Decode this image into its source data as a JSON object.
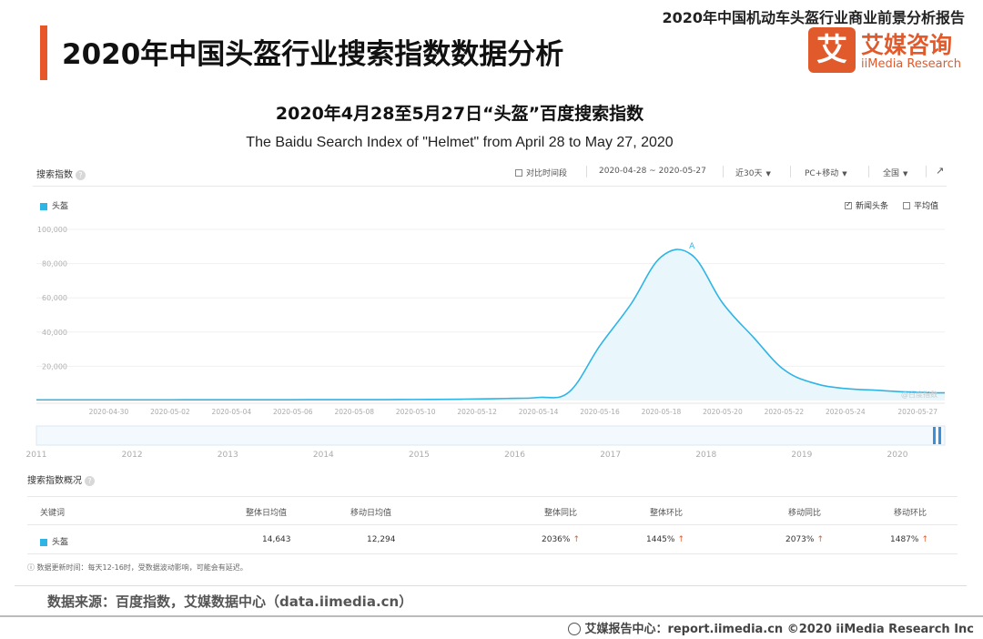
{
  "header": {
    "report_title": "2020年中国机动车头盔行业商业前景分析报告",
    "page_title": "2020年中国头盔行业搜索指数数据分析",
    "logo_mark": "艾",
    "logo_cn": "艾媒咨询",
    "logo_en": "iiMedia Research",
    "brand_color": "#e05a2b"
  },
  "chart_heading": {
    "title": "2020年4月28至5月27日“头盔”百度搜索指数",
    "subtitle": "The Baidu Search Index of \"Helmet\" from April 28 to May 27, 2020"
  },
  "screenshot": {
    "panel_label": "搜索指数",
    "help_icon": "?",
    "toolbar": {
      "compare_label": "对比时间段",
      "date_range": "2020-04-28 ~ 2020-05-27",
      "period": "近30天",
      "device": "PC+移动",
      "region": "全国",
      "share_icon": "share-icon"
    },
    "options": {
      "news_label": "新闻头条",
      "news_checked": true,
      "avg_label": "平均值",
      "avg_checked": false
    },
    "watermark": "@百度指数",
    "peak_marker": "A",
    "overview": {
      "title": "搜索指数概况",
      "columns": [
        "关键词",
        "整体日均值",
        "移动日均值",
        "整体同比",
        "整体环比",
        "移动同比",
        "移动环比"
      ],
      "row": {
        "keyword": "头盔",
        "overall_daily_avg": "14,643",
        "mobile_daily_avg": "12,294",
        "overall_yoy": "2036%",
        "overall_mom": "1445%",
        "mobile_yoy": "2073%",
        "mobile_mom": "1487%"
      },
      "up_arrow": "↑",
      "note": "ⓘ 数据更新时间：每天12-16时，受数据波动影响，可能会有延迟。"
    }
  },
  "chart_data": {
    "type": "area",
    "series": [
      {
        "name": "头盔",
        "color": "#2fb4e6",
        "x": [
          "2020-04-28",
          "2020-04-29",
          "2020-04-30",
          "2020-05-01",
          "2020-05-02",
          "2020-05-03",
          "2020-05-04",
          "2020-05-05",
          "2020-05-06",
          "2020-05-07",
          "2020-05-08",
          "2020-05-09",
          "2020-05-10",
          "2020-05-11",
          "2020-05-12",
          "2020-05-13",
          "2020-05-14",
          "2020-05-15",
          "2020-05-16",
          "2020-05-17",
          "2020-05-18",
          "2020-05-19",
          "2020-05-20",
          "2020-05-21",
          "2020-05-22",
          "2020-05-23",
          "2020-05-24",
          "2020-05-25",
          "2020-05-26",
          "2020-05-27"
        ],
        "values": [
          400,
          400,
          400,
          400,
          400,
          450,
          450,
          450,
          450,
          500,
          500,
          500,
          600,
          700,
          900,
          1200,
          1800,
          5000,
          32000,
          56000,
          84000,
          85000,
          57000,
          37000,
          18000,
          10000,
          7000,
          6000,
          5000,
          4500
        ]
      }
    ],
    "x_tick_labels": [
      "2020-04-30",
      "2020-05-02",
      "2020-05-04",
      "2020-05-06",
      "2020-05-08",
      "2020-05-10",
      "2020-05-12",
      "2020-05-14",
      "2020-05-16",
      "2020-05-18",
      "2020-05-20",
      "2020-05-22",
      "2020-05-24",
      "2020-05-27"
    ],
    "y_tick_labels": [
      "20,000",
      "40,000",
      "60,000",
      "80,000",
      "100,000"
    ],
    "ylim": [
      0,
      100000
    ],
    "grid": true,
    "area_fill": "#e9f7fc",
    "range_axis_labels": [
      "2011",
      "2012",
      "2013",
      "2014",
      "2015",
      "2016",
      "2017",
      "2018",
      "2019",
      "2020"
    ]
  },
  "source": "数据来源：百度指数，艾媒数据中心（data.iimedia.cn）",
  "footer": "艾媒报告中心：report.iimedia.cn  ©2020  iiMedia Research  Inc"
}
